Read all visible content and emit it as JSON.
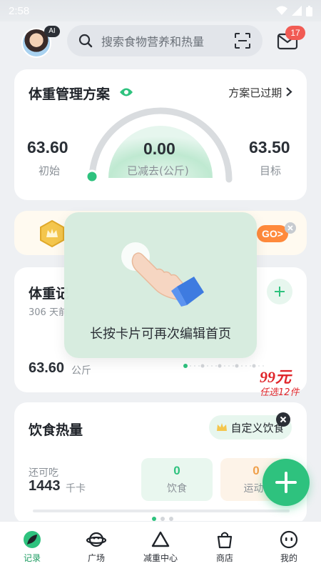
{
  "status": {
    "time": "2:58"
  },
  "header": {
    "ai_badge": "AI",
    "search_placeholder": "搜索食物营养和热量",
    "mail_count": "17"
  },
  "weight_plan": {
    "title": "体重管理方案",
    "status": "方案已过期",
    "start_value": "63.60",
    "start_label": "初始",
    "lost_value": "0.00",
    "lost_label": "已减去(公斤)",
    "target_value": "63.50",
    "target_label": "目标"
  },
  "promo": {
    "go_label": "GO>"
  },
  "weight_record": {
    "title": "体重记",
    "subtitle": "306 天前",
    "value": "63.60",
    "unit": "公斤"
  },
  "sticker": {
    "price": "99元",
    "sub": "任选12件"
  },
  "diet": {
    "title": "饮食热量",
    "custom_button": "自定义饮食",
    "remaining_label": "还可吃",
    "remaining_value": "1443",
    "remaining_unit": "千卡",
    "food_value": "0",
    "food_label": "饮食",
    "exercise_value": "0",
    "exercise_label": "运动*"
  },
  "tip": {
    "text": "长按卡片可再次编辑首页"
  },
  "tabs": [
    {
      "label": "记录",
      "icon": "leaf-icon",
      "active": true
    },
    {
      "label": "广场",
      "icon": "planet-icon",
      "active": false
    },
    {
      "label": "减重中心",
      "icon": "triangle-icon",
      "active": false
    },
    {
      "label": "商店",
      "icon": "bag-icon",
      "active": false
    },
    {
      "label": "我的",
      "icon": "face-icon",
      "active": false
    }
  ],
  "colors": {
    "accent": "#2ec27e",
    "badge": "#f15b54",
    "promo": "#ff8a3c"
  }
}
